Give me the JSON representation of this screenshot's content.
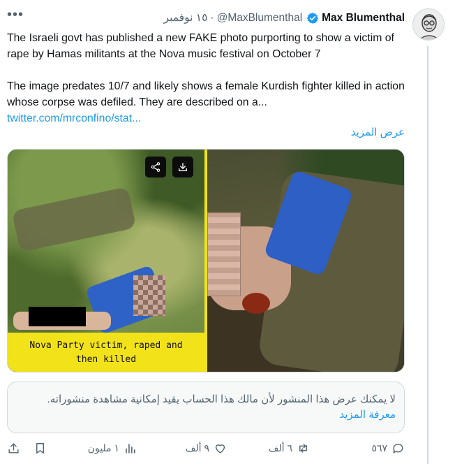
{
  "author": {
    "display_name": "Max Blumenthal",
    "handle": "@MaxBlumenthal",
    "timestamp": "١٥ نوفمبر",
    "separator": "·"
  },
  "tweet": {
    "paragraph1": "The Israeli govt has published a new FAKE photo purporting to show a victim of rape by Hamas militants at the Nova music festival on October 7",
    "paragraph2": "The image predates 10/7 and likely shows a female Kurdish fighter killed in action whose corpse was defiled. They are described on a...",
    "link_text": "twitter.com/mrconfino/stat...",
    "show_more": "عرض المزيد"
  },
  "media": {
    "caption": "Nova Party victim, raped and\nthen killed"
  },
  "notice": {
    "text": "لا يمكنك عرض هذا المنشور لأن مالك هذا الحساب يقيد إمكانية مشاهدة منشوراته.",
    "link": "معرفة المزيد"
  },
  "actions": {
    "replies": "٥٦٧",
    "reposts": "٦ ألف",
    "likes": "٩ ألف",
    "views": "١ مليون"
  },
  "colors": {
    "accent": "#1d9bf0",
    "caption_bg": "#f2e21a",
    "secondary_text": "#536471"
  }
}
